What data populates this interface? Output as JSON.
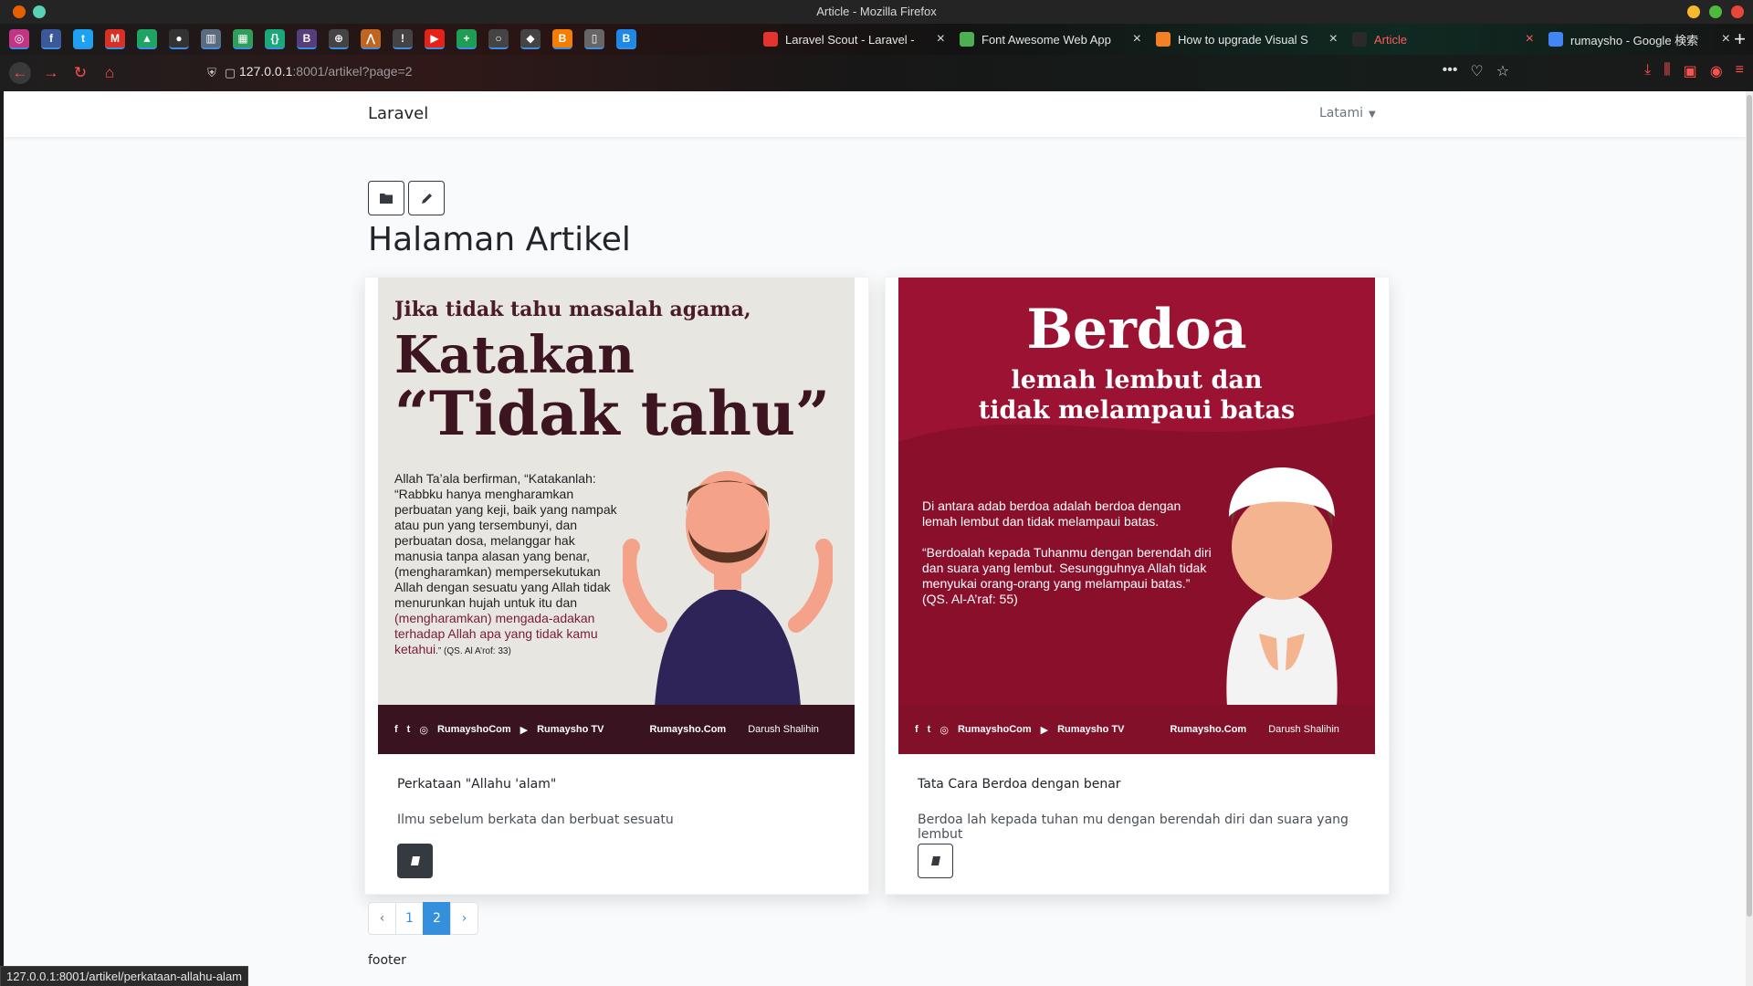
{
  "window": {
    "title": "Article - Mozilla Firefox"
  },
  "pinned_tabs": [
    {
      "name": "instagram",
      "glyph": "◎",
      "color": "#c13584"
    },
    {
      "name": "facebook",
      "glyph": "f",
      "color": "#3b5998"
    },
    {
      "name": "twitter",
      "glyph": "t",
      "color": "#1da1f2"
    },
    {
      "name": "gmail",
      "glyph": "M",
      "color": "#d93025"
    },
    {
      "name": "drive",
      "glyph": "▲",
      "color": "#1fa463"
    },
    {
      "name": "github",
      "glyph": "●",
      "color": "#333333"
    },
    {
      "name": "trello",
      "glyph": "▥",
      "color": "#5a6b7f"
    },
    {
      "name": "sheets",
      "glyph": "▦",
      "color": "#2e9e5b"
    },
    {
      "name": "code",
      "glyph": "{}",
      "color": "#1aa87a"
    },
    {
      "name": "bootstrap",
      "glyph": "B",
      "color": "#563d7c"
    },
    {
      "name": "web",
      "glyph": "⊕",
      "color": "#444444"
    },
    {
      "name": "aws",
      "glyph": "⋀",
      "color": "#c0651f"
    },
    {
      "name": "alert",
      "glyph": "!",
      "color": "#444444"
    },
    {
      "name": "youtube",
      "glyph": "▶",
      "color": "#e62117"
    },
    {
      "name": "plus",
      "glyph": "+",
      "color": "#1f9d55"
    },
    {
      "name": "circle",
      "glyph": "○",
      "color": "#444444"
    },
    {
      "name": "gem",
      "glyph": "◆",
      "color": "#444444"
    },
    {
      "name": "blogger",
      "glyph": "B",
      "color": "#f57d00"
    },
    {
      "name": "cup",
      "glyph": "▯",
      "color": "#666666"
    },
    {
      "name": "b-blue",
      "glyph": "B",
      "color": "#1e88e5"
    }
  ],
  "tabs": [
    {
      "label": "Laravel Scout - Laravel -",
      "icon_color": "#e3342f",
      "active": false
    },
    {
      "label": "Font Awesome Web App",
      "icon_color": "#4caf50",
      "active": false
    },
    {
      "label": "How to upgrade Visual S",
      "icon_color": "#f48024",
      "active": false
    },
    {
      "label": "Article",
      "icon_color": "#2a2a2a",
      "active": true
    },
    {
      "label": "rumaysho - Google 検索",
      "icon_color": "#4285f4",
      "active": false
    }
  ],
  "toolbar": {
    "url_host": "127.0.0.1",
    "url_rest": ":8001/artikel?page=2"
  },
  "app": {
    "brand": "Laravel",
    "user": "Latami",
    "page_title": "Halaman Artikel",
    "footer": "footer"
  },
  "articles": [
    {
      "title": "Perkataan \"Allahu 'alam\"",
      "description": "Ilmu sebelum berkata dan berbuat sesuatu",
      "button_style": "dark",
      "poster": {
        "line1": "Jika tidak tahu masalah agama,",
        "line2": "Katakan",
        "line3": "“Tidak tahu”",
        "body": "Allah Ta’ala berfirman, “Katakanlah: “Rabbku hanya mengharamkan perbuatan yang keji, baik yang nampak atau pun yang tersembunyi, dan perbuatan dosa, melanggar hak manusia tanpa alasan yang benar, (mengharamkan) mempersekutukan Allah dengan sesuatu yang Allah tidak menurunkan hujah untuk itu dan",
        "body_red": "(mengharamkan) mengada-adakan terhadap Allah apa yang tidak kamu ketahui",
        "ref": ".” (QS. Al A’rof: 33)",
        "footer_site": "RumayshoCom",
        "footer_tv": "Rumaysho TV",
        "footer_domain": "Rumaysho.Com",
        "footer_logo": "Darush Shalihin"
      }
    },
    {
      "title": "Tata Cara Berdoa dengan benar",
      "description": "Berdoa lah kepada tuhan mu dengan berendah diri dan suara yang lembut",
      "button_style": "light",
      "poster": {
        "line1": "Berdoa",
        "line2": "lemah lembut dan",
        "line3": "tidak melampaui batas",
        "body": "Di antara adab berdoa adalah berdoa dengan lemah lembut dan tidak melampaui batas.",
        "quote": "“Berdoalah kepada Tuhanmu dengan berendah diri dan suara yang lembut. Sesungguhnya Allah tidak menyukai orang-orang yang melampaui batas.”",
        "ref": "(QS. Al-A’raf: 55)",
        "footer_site": "RumayshoCom",
        "footer_tv": "Rumaysho TV",
        "footer_domain": "Rumaysho.Com",
        "footer_logo": "Darush Shalihin"
      }
    }
  ],
  "pagination": {
    "prev": "‹",
    "pages": [
      "1",
      "2"
    ],
    "current": "2",
    "next": "›"
  },
  "status_bar": {
    "link": "127.0.0.1:8001/artikel/perkataan-allahu-alam"
  },
  "colors": {
    "accent": "#3490dc",
    "firefox_red": "#ff5050",
    "dark_btn": "#343a40"
  }
}
